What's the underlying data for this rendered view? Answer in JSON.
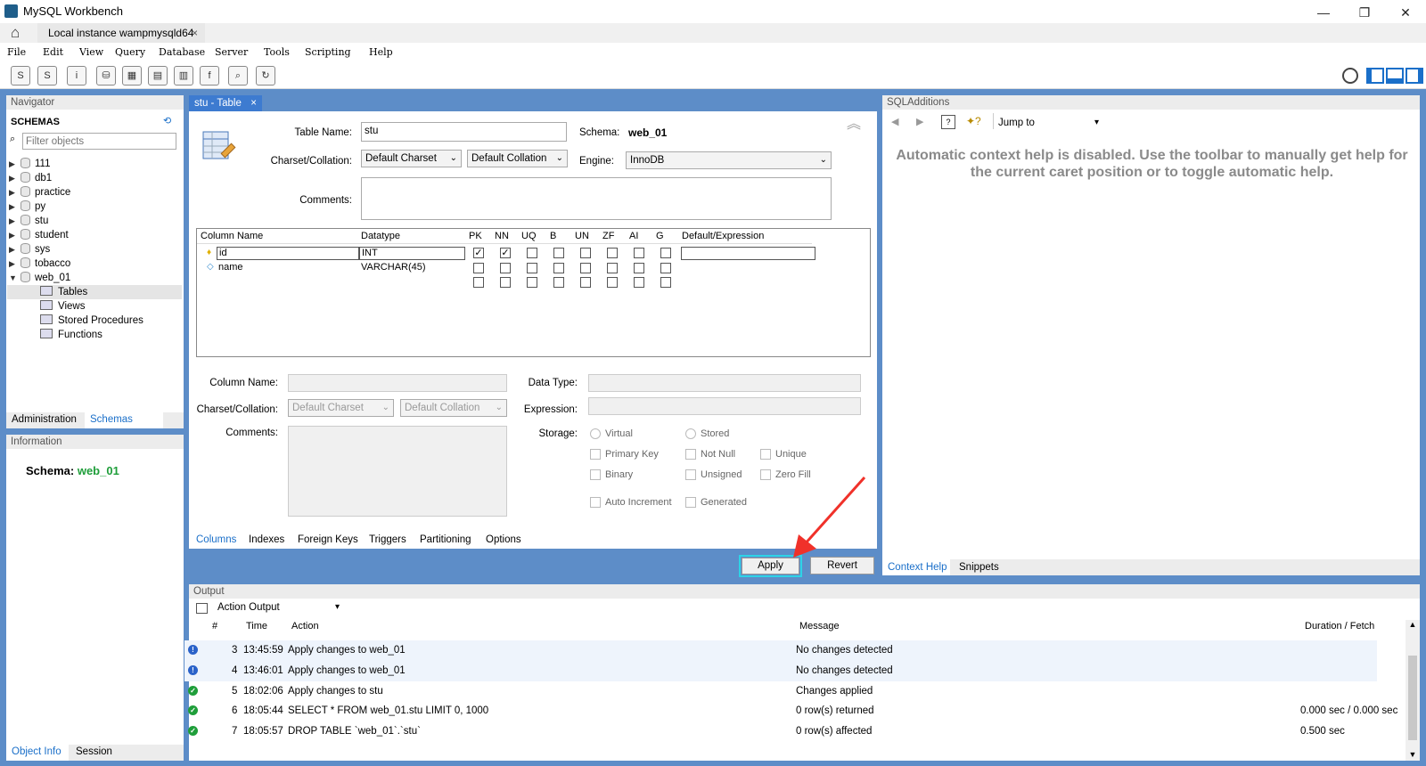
{
  "app": {
    "title": "MySQL Workbench",
    "connection_tab": "Local instance wampmysqld64"
  },
  "window_controls": {
    "minimize": "—",
    "restore": "❐",
    "close": "✕"
  },
  "menu": [
    "File",
    "Edit",
    "View",
    "Query",
    "Database",
    "Server",
    "Tools",
    "Scripting",
    "Help"
  ],
  "navigator": {
    "header": "Navigator",
    "schemas_label": "SCHEMAS",
    "filter_placeholder": "Filter objects",
    "schemas": [
      "111",
      "db1",
      "practice",
      "py",
      "stu",
      "student",
      "sys",
      "tobacco",
      "web_01"
    ],
    "children": [
      "Tables",
      "Views",
      "Stored Procedures",
      "Functions"
    ],
    "tabs": [
      "Administration",
      "Schemas"
    ]
  },
  "information": {
    "header": "Information",
    "schema_label": "Schema:",
    "schema_value": "web_01",
    "tabs": [
      "Object Info",
      "Session"
    ]
  },
  "editor": {
    "tab": "stu - Table",
    "table_name_label": "Table Name:",
    "table_name": "stu",
    "schema_label": "Schema:",
    "schema_value": "web_01",
    "charset_label": "Charset/Collation:",
    "charset": "Default Charset",
    "collation": "Default Collation",
    "engine_label": "Engine:",
    "engine": "InnoDB",
    "comments_label": "Comments:",
    "grid_headers": [
      "Column Name",
      "Datatype",
      "PK",
      "NN",
      "UQ",
      "B",
      "UN",
      "ZF",
      "AI",
      "G",
      "Default/Expression"
    ],
    "rows": [
      {
        "name": "id",
        "type": "INT",
        "flags": [
          true,
          true,
          false,
          false,
          false,
          false,
          false,
          false
        ]
      },
      {
        "name": "name",
        "type": "VARCHAR(45)",
        "flags": [
          false,
          false,
          false,
          false,
          false,
          false,
          false,
          false
        ]
      }
    ],
    "detail": {
      "column_name_label": "Column Name:",
      "charset_label": "Charset/Collation:",
      "comments_label": "Comments:",
      "charset": "Default Charset",
      "collation": "Default Collation",
      "data_type_label": "Data Type:",
      "expression_label": "Expression:",
      "storage_label": "Storage:",
      "virtual": "Virtual",
      "stored": "Stored",
      "primary_key": "Primary Key",
      "not_null": "Not Null",
      "unique": "Unique",
      "binary": "Binary",
      "unsigned": "Unsigned",
      "zero_fill": "Zero Fill",
      "auto_increment": "Auto Increment",
      "generated": "Generated"
    },
    "tabs": [
      "Columns",
      "Indexes",
      "Foreign Keys",
      "Triggers",
      "Partitioning",
      "Options"
    ],
    "apply": "Apply",
    "revert": "Revert"
  },
  "sqladditions": {
    "header": "SQLAdditions",
    "jump_to": "Jump to",
    "help_text": "Automatic context help is disabled. Use the toolbar to manually get help for the current caret position or to toggle automatic help.",
    "tabs": [
      "Context Help",
      "Snippets"
    ]
  },
  "output": {
    "header": "Output",
    "selector": "Action Output",
    "columns": [
      "#",
      "Time",
      "Action",
      "Message",
      "Duration / Fetch"
    ],
    "rows": [
      {
        "n": "3",
        "time": "13:45:59",
        "action": "Apply changes to web_01",
        "message": "No changes detected",
        "duration": "",
        "status": "info"
      },
      {
        "n": "4",
        "time": "13:46:01",
        "action": "Apply changes to web_01",
        "message": "No changes detected",
        "duration": "",
        "status": "info"
      },
      {
        "n": "5",
        "time": "18:02:06",
        "action": "Apply changes to stu",
        "message": "Changes applied",
        "duration": "",
        "status": "ok"
      },
      {
        "n": "6",
        "time": "18:05:44",
        "action": "SELECT * FROM web_01.stu LIMIT 0, 1000",
        "message": "0 row(s) returned",
        "duration": "0.000 sec / 0.000 sec",
        "status": "ok"
      },
      {
        "n": "7",
        "time": "18:05:57",
        "action": "DROP TABLE `web_01`.`stu`",
        "message": "0 row(s) affected",
        "duration": "0.500 sec",
        "status": "ok"
      }
    ]
  },
  "colors": {
    "workspace": "#5d8dc8",
    "accent": "#1a6fc9",
    "ok": "#1f9e3a",
    "info": "#2a62c9",
    "annotation_arrow": "#f0312a",
    "apply_highlight": "#2ed3e6"
  }
}
